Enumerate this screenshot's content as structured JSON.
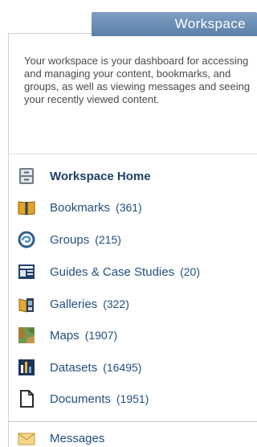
{
  "tab": {
    "title": "Workspace"
  },
  "description": "Your workspace is your dashboard for accessing and managing your content, bookmarks, and groups, as well as viewing messages and seeing your recently viewed content.",
  "nav": {
    "items": [
      {
        "label": "Workspace Home",
        "count": "",
        "icon": "cabinet-icon"
      },
      {
        "label": "Bookmarks",
        "count": "(361)",
        "icon": "book-icon"
      },
      {
        "label": "Groups",
        "count": "(215)",
        "icon": "groups-icon"
      },
      {
        "label": "Guides & Case Studies",
        "count": "(20)",
        "icon": "guide-icon"
      },
      {
        "label": "Galleries",
        "count": "(322)",
        "icon": "gallery-icon"
      },
      {
        "label": "Maps",
        "count": "(1907)",
        "icon": "map-icon"
      },
      {
        "label": "Datasets",
        "count": "(16495)",
        "icon": "chart-icon"
      },
      {
        "label": "Documents",
        "count": "(1951)",
        "icon": "document-icon"
      },
      {
        "label": "Messages",
        "count": "",
        "icon": "envelope-icon"
      }
    ]
  }
}
